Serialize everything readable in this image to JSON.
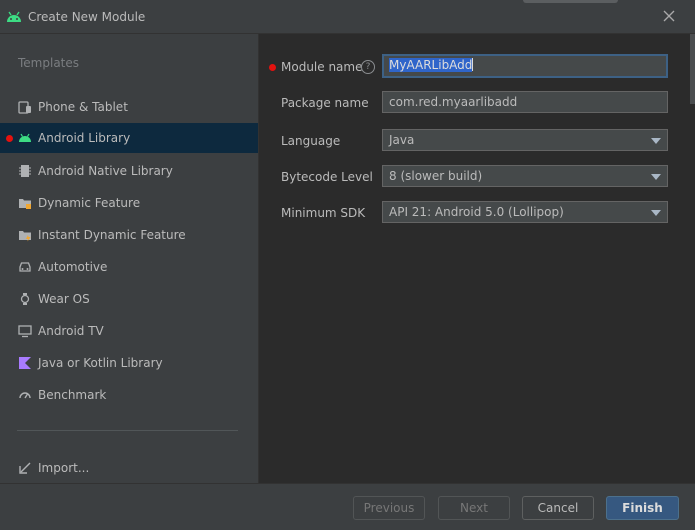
{
  "window": {
    "title": "Create New Module"
  },
  "sidebar": {
    "heading": "Templates",
    "items": [
      {
        "label": "Phone & Tablet",
        "icon": "phone-tablet-icon"
      },
      {
        "label": "Android Library",
        "icon": "android-icon",
        "selected": true
      },
      {
        "label": "Android Native Library",
        "icon": "native-library-icon"
      },
      {
        "label": "Dynamic Feature",
        "icon": "dynamic-feature-icon"
      },
      {
        "label": "Instant Dynamic Feature",
        "icon": "instant-feature-icon"
      },
      {
        "label": "Automotive",
        "icon": "car-icon"
      },
      {
        "label": "Wear OS",
        "icon": "watch-icon"
      },
      {
        "label": "Android TV",
        "icon": "tv-icon"
      },
      {
        "label": "Java or Kotlin Library",
        "icon": "kotlin-icon"
      },
      {
        "label": "Benchmark",
        "icon": "gauge-icon"
      }
    ],
    "import_label": "Import..."
  },
  "form": {
    "module_name": {
      "label": "Module name",
      "value": "MyAARLibAdd"
    },
    "package_name": {
      "label": "Package name",
      "value": "com.red.myaarlibadd"
    },
    "language": {
      "label": "Language",
      "value": "Java"
    },
    "bytecode_level": {
      "label": "Bytecode Level",
      "value": "8 (slower build)"
    },
    "minimum_sdk": {
      "label": "Minimum SDK",
      "value": "API 21: Android 5.0 (Lollipop)"
    }
  },
  "footer": {
    "previous": "Previous",
    "next": "Next",
    "cancel": "Cancel",
    "finish": "Finish"
  },
  "colors": {
    "accent": "#3ddc84",
    "selection": "#0d293e",
    "required": "#e3120f",
    "primary_button": "#365880"
  }
}
